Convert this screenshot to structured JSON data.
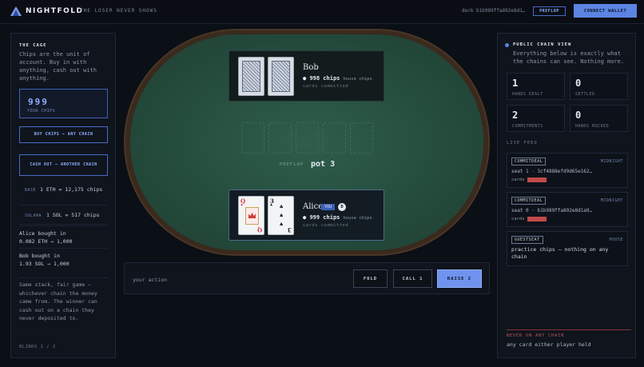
{
  "header": {
    "brand": "NIGHTFOLD",
    "tagline": "THE LOSER NEVER SHOWS",
    "deck": "deck b1b989ffa892e8d1…",
    "phase_button": "PREFLOP",
    "wallet_button": "CONNECT WALLET"
  },
  "left": {
    "title": "THE CAGE",
    "description": "Chips are the unit of account. Buy in with anything, cash out with anything.",
    "chips_value": "999",
    "chips_label": "YOUR CHIPS",
    "buy_button": "BUY CHIPS — ANY CHAIN",
    "cash_button": "CASH OUT — ANOTHER CHAIN",
    "rates": [
      {
        "chain": "BASE",
        "value": "1 ETH = 12,175 chips"
      },
      {
        "chain": "SOLANA",
        "value": "1 SOL = 517 chips"
      }
    ],
    "buyins": [
      {
        "line1": "Alice bought in",
        "line2": "0.082 ETH → 1,000"
      },
      {
        "line1": "Bob bought in",
        "line2": "1.93 SOL → 1,000"
      }
    ],
    "fair_text": "Same stack, fair game — whichever chain the money came from. The winner can cash out on a chain they never deposited to.",
    "blinds": "BLINDS 1 / 2"
  },
  "table": {
    "bob": {
      "name": "Bob",
      "chips": "998 chips",
      "unit": "house chips",
      "sub": "cards committed"
    },
    "alice": {
      "name": "Alice",
      "you": "YOU",
      "dealer": "D",
      "chips": "999 chips",
      "unit": "house chips",
      "sub": "cards committed",
      "cards": [
        {
          "rank": "Q",
          "suit": "♦",
          "color": "#d23a3a"
        },
        {
          "rank": "3",
          "suit": "♣",
          "color": "#1a1a1a"
        }
      ]
    },
    "phase": "PREFLOP",
    "pot": "pot 3"
  },
  "actions": {
    "label": "your action",
    "fold": "FOLD",
    "call": "CALL 1",
    "raise": "RAISE 2"
  },
  "right": {
    "title": "PUBLIC CHAIN VIEW",
    "description": "Everything below is exactly what the chains can see. Nothing more.",
    "stats": [
      {
        "num": "1",
        "label": "HANDS DEALT"
      },
      {
        "num": "0",
        "label": "SETTLED"
      },
      {
        "num": "2",
        "label": "COMMITMENTS"
      },
      {
        "num": "0",
        "label": "HANDS MUCKED"
      }
    ],
    "feed_label": "LIVE FEED",
    "feed": [
      {
        "tag": "COMMITDEAL",
        "right": "MIDNIGHT",
        "text": "seat 1 · 3cf4888efd9d65e162…",
        "cards": "cards"
      },
      {
        "tag": "COMMITDEAL",
        "right": "MIDNIGHT",
        "text": "seat 0 · b1b989ffa892e8d1a9…",
        "cards": "cards"
      },
      {
        "tag": "GUESTSEAT",
        "right": "HOUSE",
        "text": "practice chips — nothing on any chain"
      }
    ],
    "never_label": "NEVER ON ANY CHAIN",
    "never_value": "any card either player held"
  },
  "colors": {
    "accent": "#5b84e3",
    "felt": "#2a5443",
    "danger": "#c24a4a"
  }
}
